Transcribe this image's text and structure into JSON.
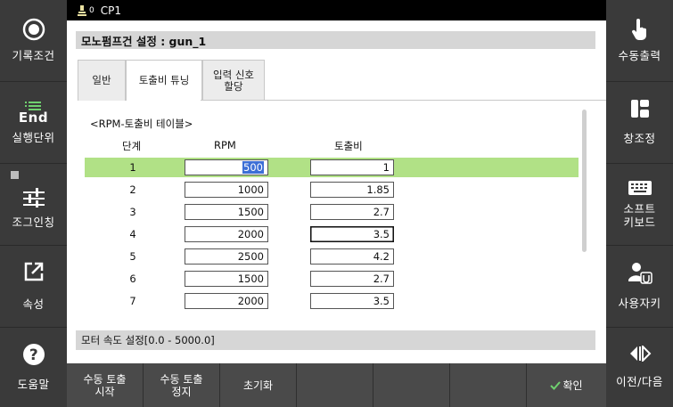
{
  "top_strip": {
    "controller": "CP1",
    "index": "0"
  },
  "left_sidebar": {
    "items": [
      {
        "label": "기록조건",
        "icon": "radio-circle-icon"
      },
      {
        "label": "실행단위",
        "icon": "end-icon",
        "icon_text": "End"
      },
      {
        "label": "조그인칭",
        "icon": "sliders-icon"
      },
      {
        "label": "속성",
        "icon": "external-link-icon"
      },
      {
        "label": "도움말",
        "icon": "help-icon"
      }
    ]
  },
  "right_sidebar": {
    "items": [
      {
        "label": "수동출력",
        "icon": "hand-pointer-icon"
      },
      {
        "label": "창조정",
        "icon": "window-layout-icon"
      },
      {
        "label_line1": "소프트",
        "label_line2": "키보드",
        "icon": "keyboard-icon"
      },
      {
        "label": "사용자키",
        "icon": "user-key-icon"
      },
      {
        "label": "이전/다음",
        "icon": "prev-next-icon"
      }
    ]
  },
  "panel": {
    "title": "모노펌프건 설정 : gun_1",
    "tabs": [
      {
        "label": "일반",
        "active": false
      },
      {
        "label": "토출비 튜닝",
        "active": true
      },
      {
        "label_line1": "입력 신호",
        "label_line2": "할당",
        "active": false
      }
    ],
    "table_title": "<RPM-토출비 테이블>",
    "columns": {
      "step": "단계",
      "rpm": "RPM",
      "ratio": "토출비"
    },
    "rows": [
      {
        "step": "1",
        "rpm": "500",
        "ratio": "1"
      },
      {
        "step": "2",
        "rpm": "1000",
        "ratio": "1.85"
      },
      {
        "step": "3",
        "rpm": "1500",
        "ratio": "2.7"
      },
      {
        "step": "4",
        "rpm": "2000",
        "ratio": "3.5"
      },
      {
        "step": "5",
        "rpm": "2500",
        "ratio": "4.2"
      },
      {
        "step": "6",
        "rpm": "1500",
        "ratio": "2.7"
      },
      {
        "step": "7",
        "rpm": "2000",
        "ratio": "3.5"
      }
    ],
    "status_text": "모터 속도 설정[0.0 - 5000.0]"
  },
  "bottom_bar": {
    "manual_start_line1": "수동 토출",
    "manual_start_line2": "시작",
    "manual_stop_line1": "수동 토출",
    "manual_stop_line2": "정지",
    "reset": "초기화",
    "confirm": "확인"
  },
  "colors": {
    "selected_row": "#b1e186",
    "selection_highlight": "#3d6fd6"
  }
}
